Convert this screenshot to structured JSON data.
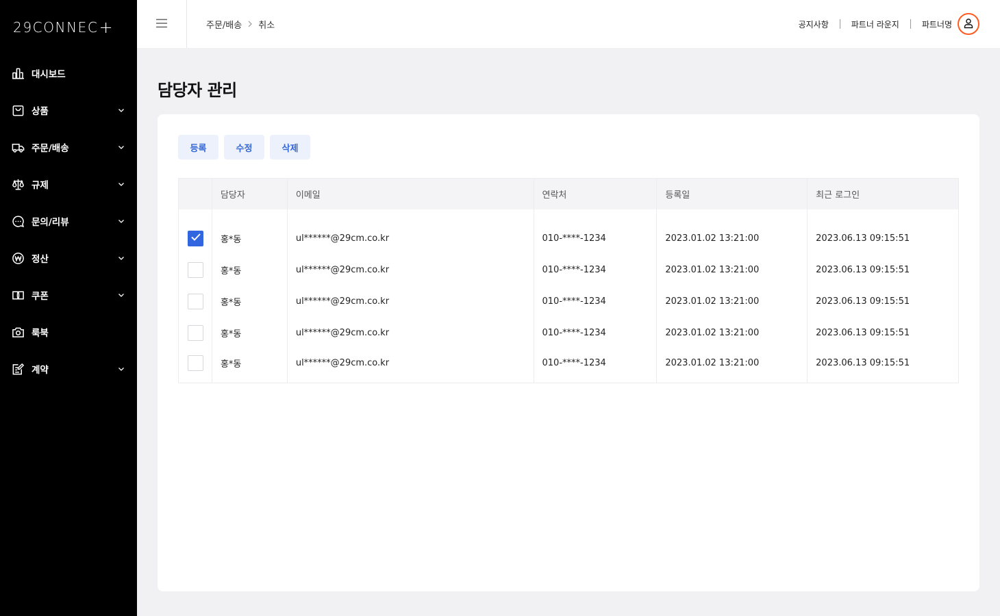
{
  "brand": {
    "logo_text": "29CONNEC",
    "logo_plus": "+"
  },
  "sidebar": {
    "items": [
      {
        "label": "대시보드",
        "icon": "bar-chart-icon",
        "expandable": false
      },
      {
        "label": "상품",
        "icon": "shopping-bag-icon",
        "expandable": true
      },
      {
        "label": "주문/배송",
        "icon": "truck-icon",
        "expandable": true
      },
      {
        "label": "규제",
        "icon": "scale-icon",
        "expandable": true
      },
      {
        "label": "문의/리뷰",
        "icon": "chat-bubble-icon",
        "expandable": true
      },
      {
        "label": "정산",
        "icon": "won-coin-icon",
        "expandable": true
      },
      {
        "label": "쿠폰",
        "icon": "coupon-icon",
        "expandable": true
      },
      {
        "label": "룩북",
        "icon": "camera-icon",
        "expandable": false
      },
      {
        "label": "계약",
        "icon": "contract-edit-icon",
        "expandable": true
      }
    ]
  },
  "header": {
    "breadcrumb": [
      "주문/배송",
      "취소"
    ],
    "links": {
      "notice": "공지사항",
      "lounge": "파트너 라운지",
      "partner_name": "파트너명"
    },
    "accent_color": "#ff5a1f"
  },
  "main": {
    "title": "담당자 관리",
    "buttons": {
      "register": "등록",
      "edit": "수정",
      "delete": "삭제"
    },
    "columns": {
      "manager": "담당자",
      "email": "이메일",
      "phone": "연락처",
      "registered": "등록일",
      "last_login": "최근 로그인"
    },
    "rows": [
      {
        "checked": true,
        "manager": "홍*동",
        "email": "ul******@29cm.co.kr",
        "phone": "010-****-1234",
        "registered": "2023.01.02 13:21:00",
        "last_login": "2023.06.13 09:15:51"
      },
      {
        "checked": false,
        "manager": "홍*동",
        "email": "ul******@29cm.co.kr",
        "phone": "010-****-1234",
        "registered": "2023.01.02 13:21:00",
        "last_login": "2023.06.13 09:15:51"
      },
      {
        "checked": false,
        "manager": "홍*동",
        "email": "ul******@29cm.co.kr",
        "phone": "010-****-1234",
        "registered": "2023.01.02 13:21:00",
        "last_login": "2023.06.13 09:15:51"
      },
      {
        "checked": false,
        "manager": "홍*동",
        "email": "ul******@29cm.co.kr",
        "phone": "010-****-1234",
        "registered": "2023.01.02 13:21:00",
        "last_login": "2023.06.13 09:15:51"
      },
      {
        "checked": false,
        "manager": "홍*동",
        "email": "ul******@29cm.co.kr",
        "phone": "010-****-1234",
        "registered": "2023.01.02 13:21:00",
        "last_login": "2023.06.13 09:15:51"
      }
    ],
    "colors": {
      "primary": "#3166e0",
      "button_bg": "#edf1fb"
    }
  }
}
